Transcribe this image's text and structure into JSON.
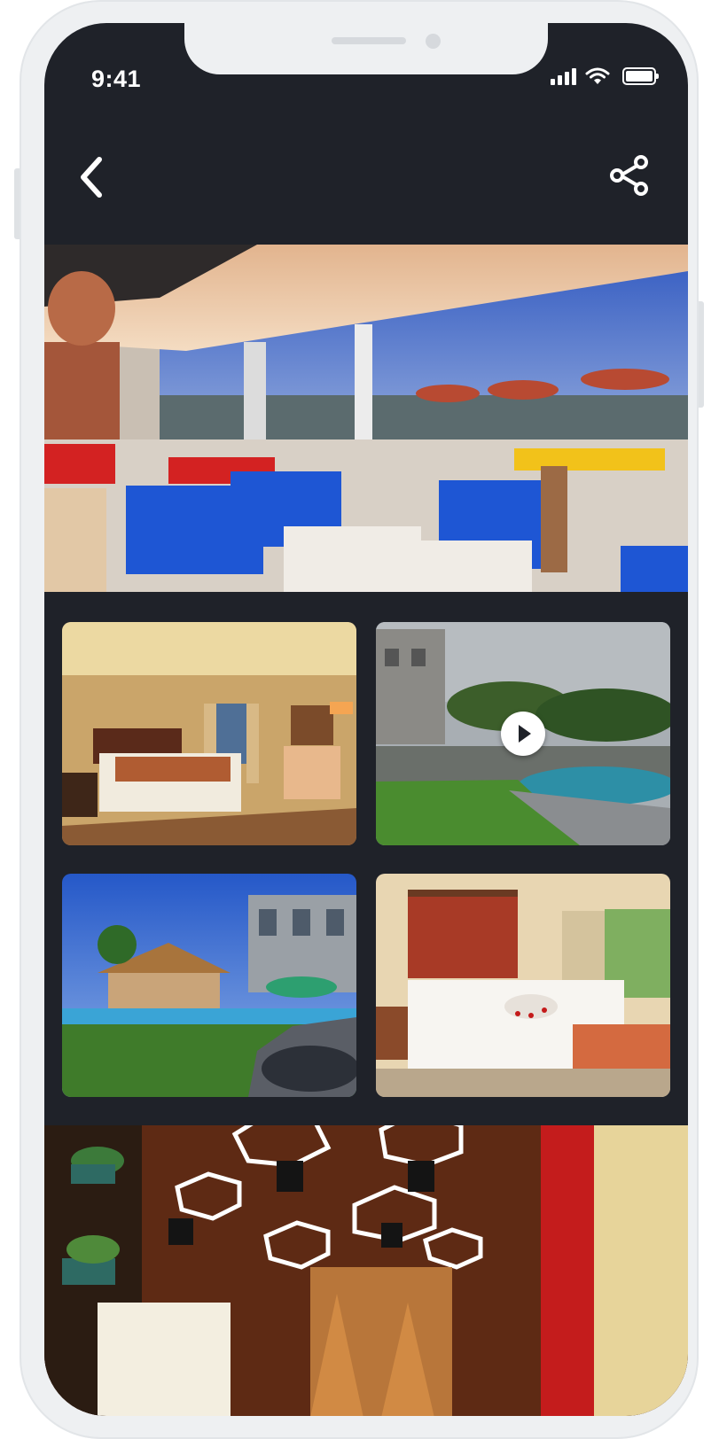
{
  "status_bar": {
    "time": "9:41",
    "icons": [
      "signal-icon",
      "wifi-icon",
      "battery-icon"
    ]
  },
  "nav_bar": {
    "back_icon": "chevron-left-icon",
    "share_icon": "share-icon"
  },
  "gallery": {
    "hero": {
      "subject": "hotel-restaurant-terrace"
    },
    "grid": [
      {
        "subject": "hotel-bedroom"
      },
      {
        "subject": "pool-garden-video",
        "has_play_button": true
      },
      {
        "subject": "hotel-exterior-pool"
      },
      {
        "subject": "suite-bed-with-flowers"
      }
    ],
    "bottom": {
      "subject": "cafe-interior-lights"
    }
  },
  "colors": {
    "background": "#1f2229",
    "frame": "#eef0f2",
    "icon": "#ffffff"
  }
}
